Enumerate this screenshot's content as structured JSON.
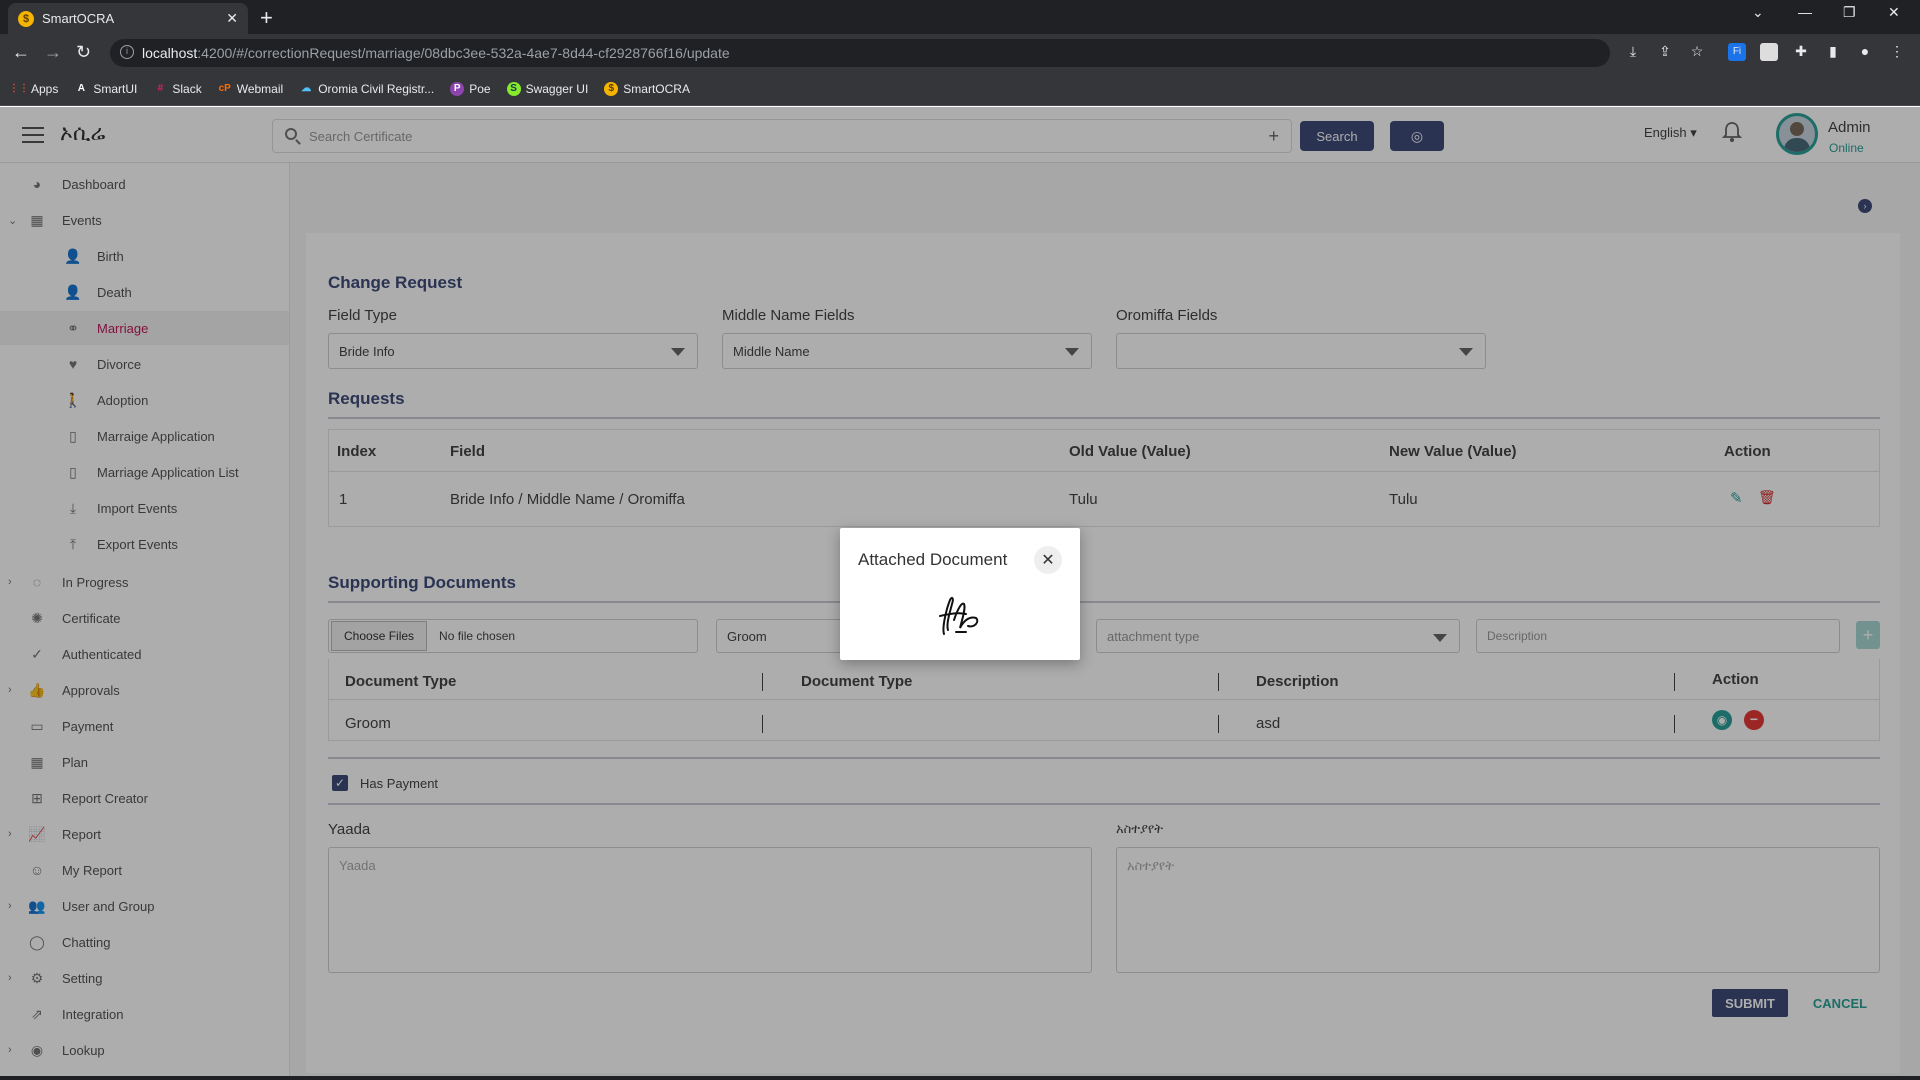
{
  "browser": {
    "tab_title": "SmartOCRA",
    "url_host": "localhost",
    "url_path": ":4200/#/correctionRequest/marriage/08dbc3ee-532a-4ae7-8d44-cf2928766f16/update",
    "bookmarks": [
      "Apps",
      "SmartUI",
      "Slack",
      "Webmail",
      "Oromia Civil Registr...",
      "Poe",
      "Swagger UI",
      "SmartOCRA"
    ]
  },
  "header": {
    "brand": "ኦሲሬ",
    "search_placeholder": "Search Certificate",
    "search_label": "Search",
    "language": "English",
    "user_name": "Admin",
    "user_status": "Online"
  },
  "sidebar": {
    "items": [
      {
        "label": "Dashboard",
        "icon": "dashboard-icon"
      },
      {
        "label": "Events",
        "icon": "calendar-icon"
      },
      {
        "label": "Birth",
        "icon": "birth-icon"
      },
      {
        "label": "Death",
        "icon": "death-icon"
      },
      {
        "label": "Marriage",
        "icon": "marriage-icon"
      },
      {
        "label": "Divorce",
        "icon": "divorce-icon"
      },
      {
        "label": "Adoption",
        "icon": "adoption-icon"
      },
      {
        "label": "Marraige Application",
        "icon": "document-icon"
      },
      {
        "label": "Marriage Application List",
        "icon": "document-icon"
      },
      {
        "label": "Import Events",
        "icon": "import-icon"
      },
      {
        "label": "Export Events",
        "icon": "export-icon"
      },
      {
        "label": "In Progress",
        "icon": "progress-icon"
      },
      {
        "label": "Certificate",
        "icon": "certificate-icon"
      },
      {
        "label": "Authenticated",
        "icon": "check-circle-icon"
      },
      {
        "label": "Approvals",
        "icon": "thumbs-up-icon"
      },
      {
        "label": "Payment",
        "icon": "payment-icon"
      },
      {
        "label": "Plan",
        "icon": "calendar-icon"
      },
      {
        "label": "Report Creator",
        "icon": "plus-square-icon"
      },
      {
        "label": "Report",
        "icon": "chart-icon"
      },
      {
        "label": "My Report",
        "icon": "smile-icon"
      },
      {
        "label": "User and Group",
        "icon": "users-icon"
      },
      {
        "label": "Chatting",
        "icon": "chat-icon"
      },
      {
        "label": "Setting",
        "icon": "gear-icon"
      },
      {
        "label": "Integration",
        "icon": "link-icon"
      },
      {
        "label": "Lookup",
        "icon": "lookup-icon"
      }
    ]
  },
  "change_request": {
    "title": "Change Request",
    "field_type_label": "Field Type",
    "field_type_value": "Bride Info",
    "middle_name_label": "Middle Name Fields",
    "middle_name_value": "Middle Name",
    "oromiffa_label": "Oromiffa Fields",
    "oromiffa_value": ""
  },
  "requests": {
    "title": "Requests",
    "columns": [
      "Index",
      "Field",
      "Old Value (Value)",
      "New Value (Value)",
      "Action"
    ],
    "rows": [
      {
        "index": "1",
        "field": "Bride Info / Middle Name / Oromiffa",
        "old": "Tulu",
        "new": "Tulu"
      }
    ]
  },
  "supporting_documents": {
    "title": "Supporting Documents",
    "choose_files": "Choose Files",
    "no_file": "No file chosen",
    "doc_type_value": "Groom",
    "attachment_placeholder": "attachment type",
    "description_placeholder": "Description",
    "columns": [
      "Document Type",
      "Document Type",
      "Description",
      "Action"
    ],
    "rows": [
      {
        "type": "Groom",
        "type2": "",
        "description": "asd"
      }
    ]
  },
  "payment": {
    "has_payment_label": "Has Payment"
  },
  "remarks": {
    "yaada_label": "Yaada",
    "yaada_placeholder": "Yaada",
    "amharic_label": "አስተያየት",
    "amharic_placeholder": "አስተያየት"
  },
  "buttons": {
    "submit": "SUBMIT",
    "cancel": "CANCEL"
  },
  "modal": {
    "title": "Attached Document"
  },
  "colors": {
    "primary": "#3f4c7a",
    "accent": "#2aa198",
    "active": "#c2185b"
  }
}
